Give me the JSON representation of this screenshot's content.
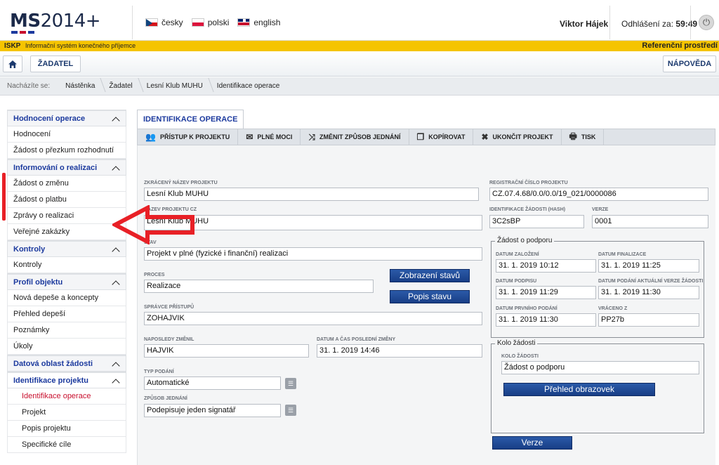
{
  "header": {
    "logo_main": "MS",
    "logo_year": "2014+",
    "languages": [
      {
        "label": "česky",
        "flag": "cz"
      },
      {
        "label": "polski",
        "flag": "pl"
      },
      {
        "label": "english",
        "flag": "en"
      }
    ],
    "user": "Viktor Hájek",
    "logout_label": "Odhlášení za:",
    "logout_time": "59:49"
  },
  "strip": {
    "code": "ISKP",
    "subtitle": "Informační systém konečného příjemce",
    "environment": "Referenční prostředí"
  },
  "toolbar": {
    "home_icon": "home-icon",
    "applicant": "ŽADATEL",
    "help": "NÁPOVĚDA"
  },
  "breadcrumb": {
    "label": "Nacházíte se:",
    "items": [
      "Nástěnka",
      "Žadatel",
      "Lesní Klub MUHU",
      "Identifikace operace"
    ]
  },
  "sidebar": {
    "sections": [
      {
        "title": "Hodnocení operace",
        "items": [
          "Hodnocení",
          "Žádost o přezkum rozhodnutí"
        ]
      },
      {
        "title": "Informování o realizaci",
        "items": [
          "Žádost o změnu",
          "Žádost o platbu",
          "Zprávy o realizaci",
          "Veřejné zakázky"
        ]
      },
      {
        "title": "Kontroly",
        "items": [
          "Kontroly"
        ]
      },
      {
        "title": "Profil objektu",
        "items": [
          "Nová depeše a koncepty",
          "Přehled depeší",
          "Poznámky",
          "Úkoly"
        ]
      },
      {
        "title": "Datová oblast žádosti",
        "items": []
      },
      {
        "title": "Identifikace projektu",
        "items": [
          "Identifikace operace",
          "Projekt",
          "Popis projektu",
          "Specifické cíle"
        ]
      }
    ]
  },
  "main": {
    "tab": "IDENTIFIKACE OPERACE",
    "actions": [
      {
        "label": "PŘÍSTUP K PROJEKTU",
        "icon": "users-icon"
      },
      {
        "label": "PLNÉ MOCI",
        "icon": "envelope-icon"
      },
      {
        "label": "ZMĚNIT ZPŮSOB JEDNÁNÍ",
        "icon": "shuffle-icon"
      },
      {
        "label": "KOPÍROVAT",
        "icon": "copy-icon"
      },
      {
        "label": "UKONČIT PROJEKT",
        "icon": "close-icon"
      },
      {
        "label": "TISK",
        "icon": "print-icon"
      }
    ],
    "fields": {
      "short_name_label": "ZKRÁCENÝ NÁZEV PROJEKTU",
      "short_name": "Lesní Klub MUHU",
      "name_cz_label": "NÁZEV PROJEKTU CZ",
      "name_cz": "Lesní Klub MUHU",
      "state_label": "STAV",
      "state": "Projekt v plné (fyzické i finanční) realizaci",
      "process_label": "PROCES",
      "process": "Realizace",
      "show_states_btn": "Zobrazení stavů",
      "state_desc_btn": "Popis stavu",
      "admin_label": "SPRÁVCE PŘÍSTUPŮ",
      "admin": "ZOHAJVIK",
      "changed_by_label": "NAPOSLEDY ZMĚNIL",
      "changed_by": "HAJVIK",
      "changed_at_label": "DATUM A ČAS POSLEDNÍ ZMĚNY",
      "changed_at": "31. 1. 2019 14:46",
      "submit_type_label": "TYP PODÁNÍ",
      "submit_type": "Automatické",
      "acting_label": "ZPŮSOB JEDNÁNÍ",
      "acting": "Podepisuje jeden signatář",
      "reg_no_label": "REGISTRAČNÍ ČÍSLO PROJEKTU",
      "reg_no": "CZ.07.4.68/0.0/0.0/19_021/0000086",
      "hash_label": "IDENTIFIKACE ŽÁDOSTI (HASH)",
      "hash": "3C2sBP",
      "version_label": "VERZE",
      "version": "0001"
    },
    "support": {
      "title": "Žádost o podporu",
      "created_label": "DATUM ZALOŽENÍ",
      "created": "31. 1. 2019 10:12",
      "finalized_label": "DATUM FINALIZACE",
      "finalized": "31. 1. 2019 11:25",
      "signed_label": "DATUM PODPISU",
      "signed": "31. 1. 2019 11:29",
      "last_submit_label": "DATUM PODÁNÍ AKTUÁLNÍ VERZE ŽÁDOSTI",
      "last_submit": "31. 1. 2019 11:30",
      "first_submit_label": "DATUM PRVNÍHO PODÁNÍ",
      "first_submit": "31. 1. 2019 11:30",
      "returned_label": "VRÁCENO Z",
      "returned": "PP27b"
    },
    "round": {
      "title": "Kolo žádosti",
      "label": "KOLO ŽÁDOSTI",
      "value": "Žádost o podporu",
      "overview_btn": "Přehled obrazovek"
    },
    "versions_btn": "Verze"
  }
}
